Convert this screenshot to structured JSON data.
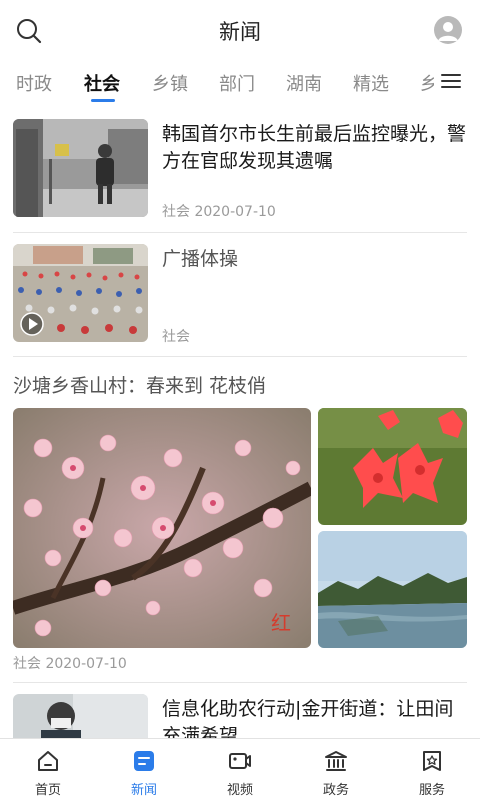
{
  "header": {
    "title": "新闻",
    "search_icon": "search-icon",
    "avatar_icon": "user-avatar-icon"
  },
  "tabs": [
    {
      "label": "时政",
      "active": false
    },
    {
      "label": "社会",
      "active": true
    },
    {
      "label": "乡镇",
      "active": false
    },
    {
      "label": "部门",
      "active": false
    },
    {
      "label": "湖南",
      "active": false
    },
    {
      "label": "精选",
      "active": false
    },
    {
      "label": "乡",
      "active": false
    }
  ],
  "accent_color": "#2b7ce9",
  "news": [
    {
      "title": "韩国首尔市长生前最后监控曝光，警方在官邸发现其遗嘱",
      "category": "社会",
      "date": "2020-07-10",
      "meta": "社会 2020-07-10"
    },
    {
      "title": "广播体操",
      "category": "社会",
      "meta": "社会",
      "has_video": true
    },
    {
      "title": "信息化助农行动|金开街道：让田间充满希望"
    }
  ],
  "album": {
    "title": "沙塘乡香山村：春来到 花枝俏",
    "meta": "社会 2020-07-10",
    "watermark": "红 网 LSEN.COM"
  },
  "bottom_nav": [
    {
      "label": "首页",
      "icon": "home-icon",
      "active": false
    },
    {
      "label": "新闻",
      "icon": "news-icon",
      "active": true
    },
    {
      "label": "视频",
      "icon": "video-icon",
      "active": false
    },
    {
      "label": "政务",
      "icon": "government-icon",
      "active": false
    },
    {
      "label": "服务",
      "icon": "service-icon",
      "active": false
    }
  ]
}
